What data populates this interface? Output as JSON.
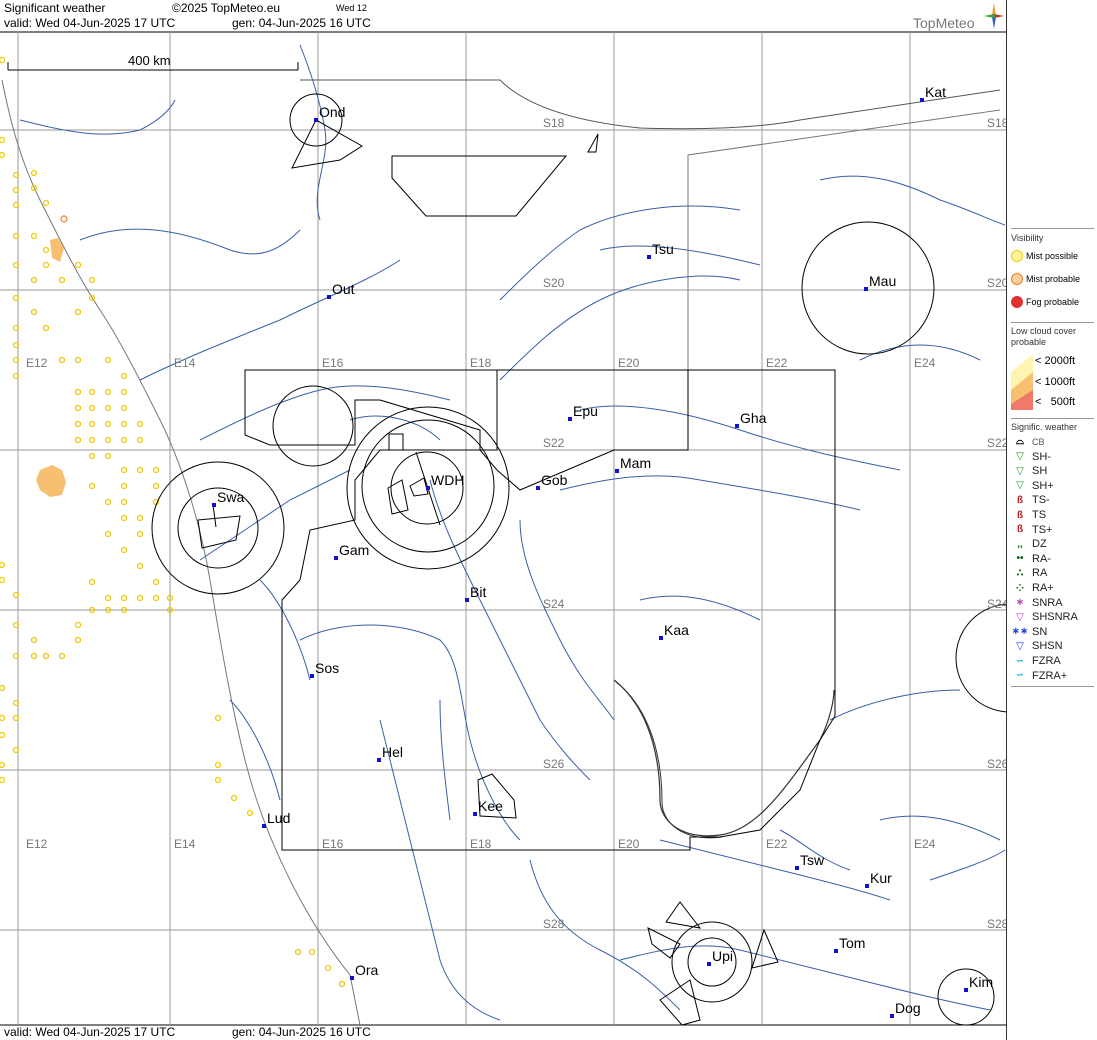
{
  "header": {
    "product": "Significant weather",
    "copyright": "©2025 TopMeteo.eu",
    "day": "Wed 12",
    "valid": "valid:  Wed  04-Jun-2025  17 UTC",
    "generated": "gen: 04-Jun-2025 16 UTC",
    "brand": "TopMeteo"
  },
  "footer": {
    "valid": "valid:  Wed  04-Jun-2025  17 UTC",
    "generated": "gen: 04-Jun-2025 16 UTC"
  },
  "scale_bar": "400 km",
  "grid_labels": {
    "longitudes": [
      "E12",
      "E14",
      "E16",
      "E18",
      "E20",
      "E22",
      "E24"
    ],
    "latitudes": [
      "S18",
      "S20",
      "S22",
      "S24",
      "S26",
      "S28"
    ]
  },
  "places": [
    "Ond",
    "Kat",
    "Tsu",
    "Out",
    "Mau",
    "Epu",
    "Gha",
    "Mam",
    "WDH",
    "Gob",
    "Swa",
    "Gam",
    "Bit",
    "Kaa",
    "Sos",
    "Hel",
    "Lud",
    "Kee",
    "Tsw",
    "Kur",
    "Tom",
    "Upi",
    "Ora",
    "Kim",
    "Dog"
  ],
  "legend": {
    "visibility_title": "Visibility",
    "mist_possible": "Mist possible",
    "mist_probable": "Mist probable",
    "fog_probable": "Fog probable",
    "low_cloud_title": "Low cloud cover probable",
    "lc_2000": "< 2000ft",
    "lc_1000": "< 1000ft",
    "lc_500": "<   500ft",
    "sigwx_title": "Signific. weather",
    "items": [
      "CB",
      "SH-",
      "SH",
      "SH+",
      "TS-",
      "TS",
      "TS+",
      "DZ",
      "RA-",
      "RA",
      "RA+",
      "SNRA",
      "SHSNRA",
      "SN",
      "SHSN",
      "FZRA",
      "FZRA+"
    ],
    "colors": {
      "mist_possible": "#f5e04a",
      "mist_probable": "#f07a1a",
      "fog_probable": "#e03030",
      "lc_2000": "#fff5b0",
      "lc_1000": "#f7c070",
      "lc_500": "#f07a6a"
    }
  }
}
